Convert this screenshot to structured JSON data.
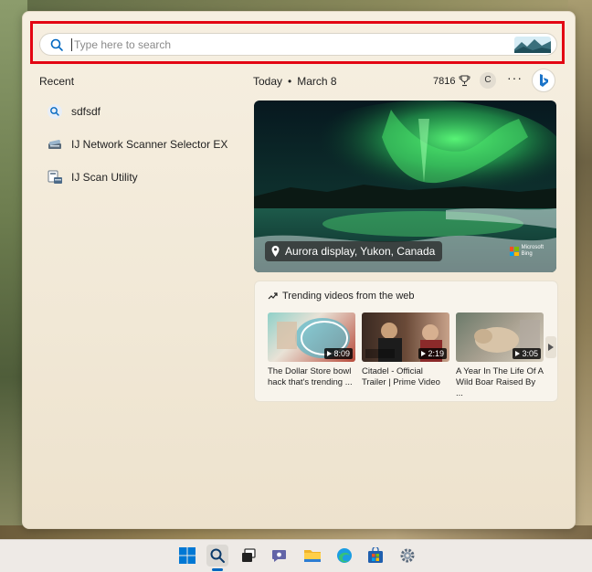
{
  "search": {
    "placeholder": "Type here to search"
  },
  "recent": {
    "title": "Recent",
    "items": [
      {
        "label": "sdfsdf",
        "icon": "search-icon"
      },
      {
        "label": "IJ Network Scanner Selector EX",
        "icon": "scanner-network-icon"
      },
      {
        "label": "IJ Scan Utility",
        "icon": "scan-utility-icon"
      }
    ]
  },
  "today": {
    "label": "Today",
    "date": "March 8",
    "points": "7816",
    "avatar_letter": "C",
    "more": "···"
  },
  "hero": {
    "caption": "Aurora display, Yukon, Canada",
    "brand_line1": "Microsoft",
    "brand_line2": "Bing"
  },
  "trending": {
    "title": "Trending videos from the web",
    "videos": [
      {
        "title_line1": "The Dollar Store bowl",
        "title_line2": "hack that's trending ...",
        "duration": "8:09"
      },
      {
        "title_line1": "Citadel - Official",
        "title_line2": "Trailer | Prime Video",
        "duration": "2:19"
      },
      {
        "title_line1": "A Year In The Life Of A",
        "title_line2": "Wild Boar Raised By ...",
        "duration": "3:05"
      }
    ]
  },
  "colors": {
    "highlight": "#e30613",
    "accent": "#0067c0"
  }
}
